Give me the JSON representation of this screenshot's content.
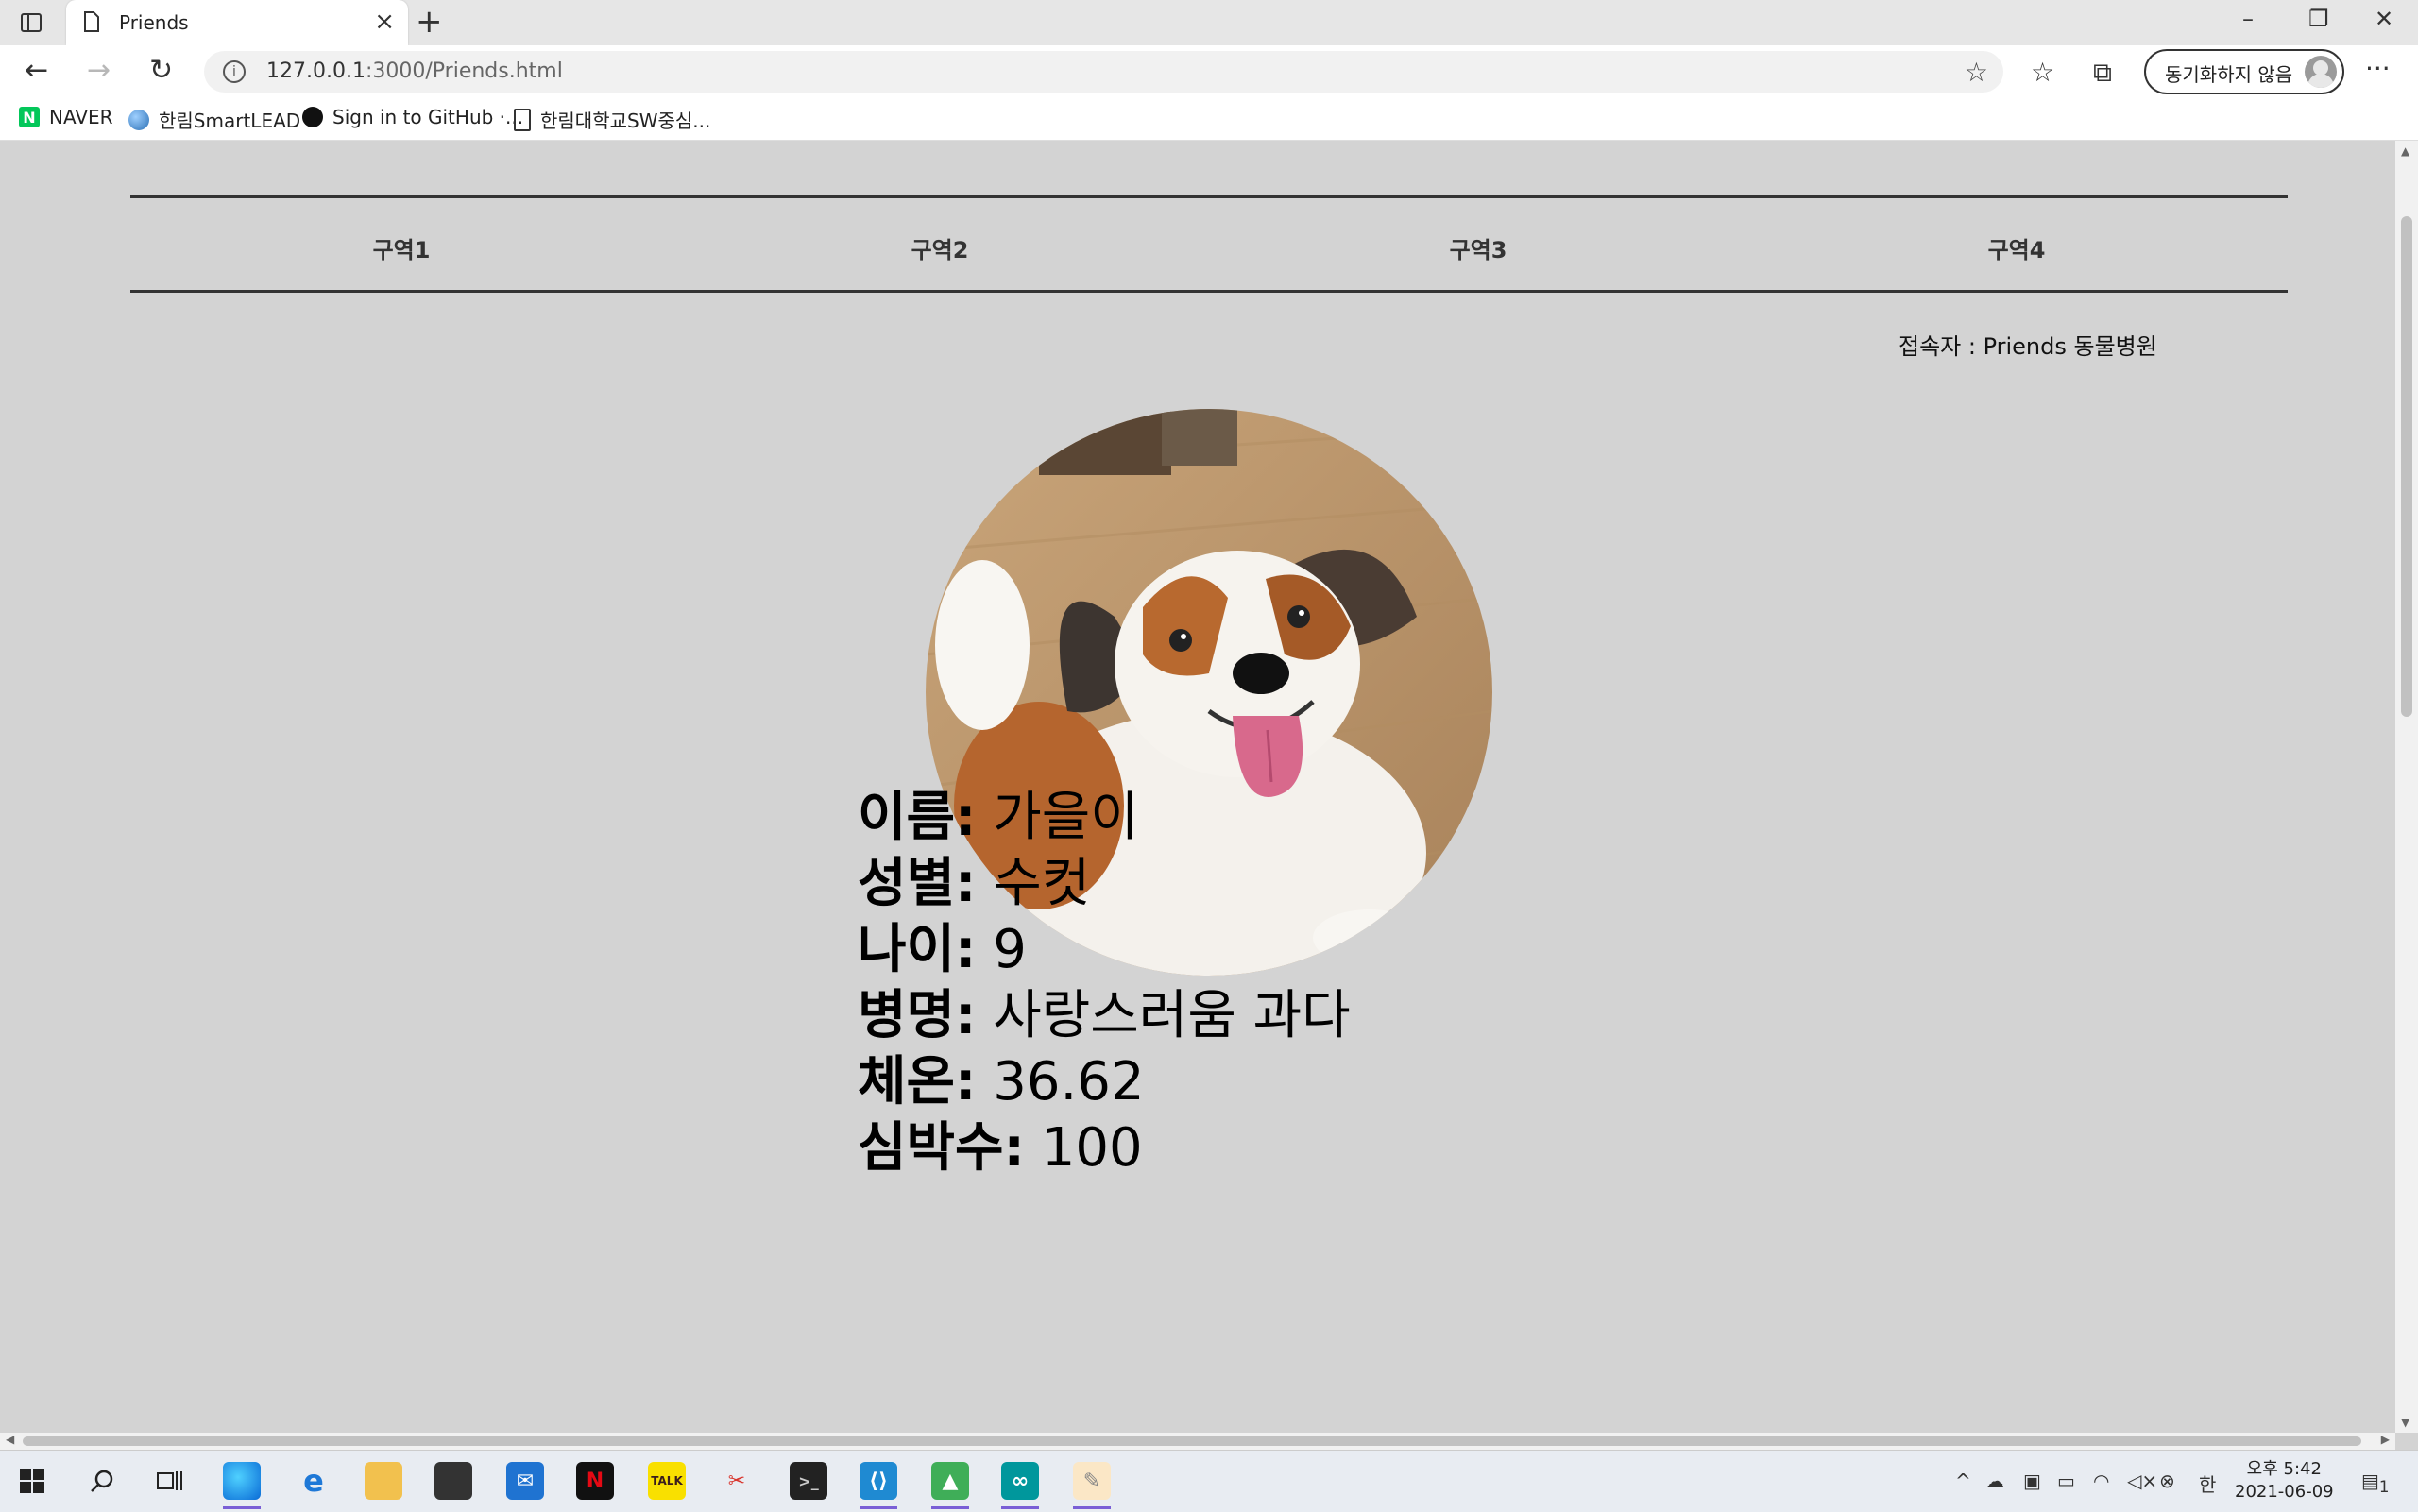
{
  "browser": {
    "tab_title": "Priends",
    "url_host": "127.0.0.1",
    "url_path": ":3000/Priends.html",
    "sync_label": "동기화하지 않음",
    "bookmarks": [
      "NAVER",
      "한림SmartLEAD",
      "Sign in to GitHub ·...",
      "한림대학교SW중심..."
    ]
  },
  "page": {
    "nav": [
      "구역1",
      "구역2",
      "구역3",
      "구역4"
    ],
    "visitor": "접속자 : Priends 동물병원",
    "pet": {
      "name_label": "이름:",
      "name": "가을이",
      "sex_label": "성별:",
      "sex": "수컷",
      "age_label": "나이:",
      "age": "9",
      "disease_label": "병명:",
      "disease": "사랑스러움 과다",
      "temp_label": "체온:",
      "temp": "36.62",
      "hr_label": "심박수:",
      "hr": "100"
    }
  },
  "taskbar": {
    "time": "오후 5:42",
    "date": "2021-06-09",
    "ime": "한",
    "notification_count": "1",
    "kakao_label": "TALK"
  },
  "colors": {
    "accent": "#7a5fd6",
    "page_bg": "#d3d3d3",
    "rule": "#333333"
  }
}
